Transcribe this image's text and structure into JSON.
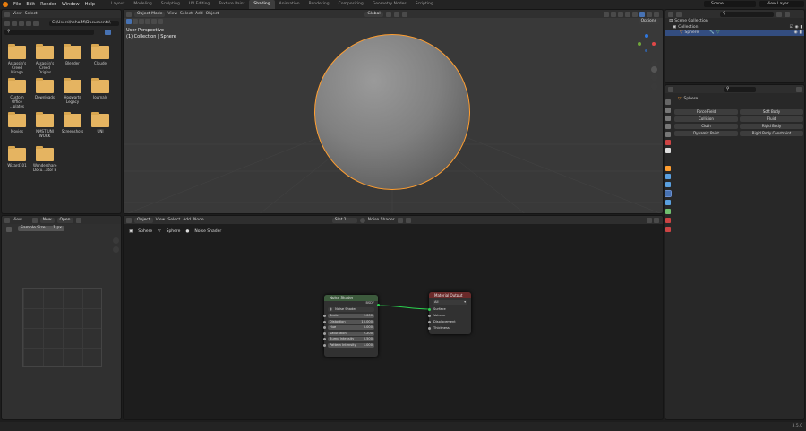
{
  "top_menu": [
    "File",
    "Edit",
    "Render",
    "Window",
    "Help"
  ],
  "workspaces": [
    "Layout",
    "Modeling",
    "Sculpting",
    "UV Editing",
    "Texture Paint",
    "Shading",
    "Animation",
    "Rendering",
    "Compositing",
    "Geometry Nodes",
    "Scripting"
  ],
  "active_workspace": "Shading",
  "scene_name": "Scene",
  "view_layer": "View Layer",
  "file_browser": {
    "menu": [
      "View",
      "Select"
    ],
    "path": "C:\\Users\\hehaiM\\Documents\\",
    "folders": [
      "Assassin's Creed Mirage",
      "Assassin's Creed Origins",
      "Blender",
      "Claude",
      "Custom Office ...plates",
      "Downloads",
      "Hogwarts Legacy",
      "Journals",
      "Movies",
      "NMST UNI WORK",
      "Screenshots",
      "UNI",
      "Wizard101",
      "Wondershare Docu...ator 8"
    ]
  },
  "viewport": {
    "mode": "Object Mode",
    "menu": [
      "View",
      "Select",
      "Add",
      "Object"
    ],
    "info_line1": "User Perspective",
    "info_line2": "(1) Collection | Sphere",
    "orientation": "Global",
    "options": "Options"
  },
  "image_editor": {
    "menu": [
      "View"
    ],
    "new_label": "New",
    "open_label": "Open",
    "sample_label": "Sample Size",
    "sample_value": "1 px"
  },
  "node_editor": {
    "menu_object": "Object",
    "menu": [
      "View",
      "Select",
      "Add",
      "Node"
    ],
    "slot": "Slot 1",
    "material": "Noise Shader",
    "breadcrumb": [
      "Sphere",
      "Sphere",
      "Noise Shader"
    ],
    "noise_node": {
      "title": "Noise Shader",
      "output": "BSDF",
      "selector": "Noise Shader",
      "fields": [
        {
          "label": "Scale",
          "value": "2.000"
        },
        {
          "label": "Distortion",
          "value": "10.000"
        },
        {
          "label": "Hue",
          "value": "0.000"
        },
        {
          "label": "Saturation",
          "value": "2.200"
        },
        {
          "label": "Bump Intensity",
          "value": "0.500"
        },
        {
          "label": "Pattern Intensity",
          "value": "1.000"
        }
      ]
    },
    "output_node": {
      "title": "Material Output",
      "target": "All",
      "inputs": [
        "Surface",
        "Volume",
        "Displacement",
        "Thickness"
      ]
    }
  },
  "outliner": {
    "search_placeholder": "",
    "scene_collection": "Scene Collection",
    "collection": "Collection",
    "object": "Sphere"
  },
  "properties": {
    "object_name": "Sphere",
    "physics_buttons": [
      "Force Field",
      "Soft Body",
      "Collision",
      "Fluid",
      "Cloth",
      "Rigid Body",
      "Dynamic Paint",
      "Rigid Body Constraint"
    ]
  },
  "version": "3.5.0",
  "colors": {
    "accent": "#4772b3",
    "selection": "#ff9e30",
    "node_header_green": "#3c5a3c",
    "node_header_red": "#6b2a2a"
  }
}
